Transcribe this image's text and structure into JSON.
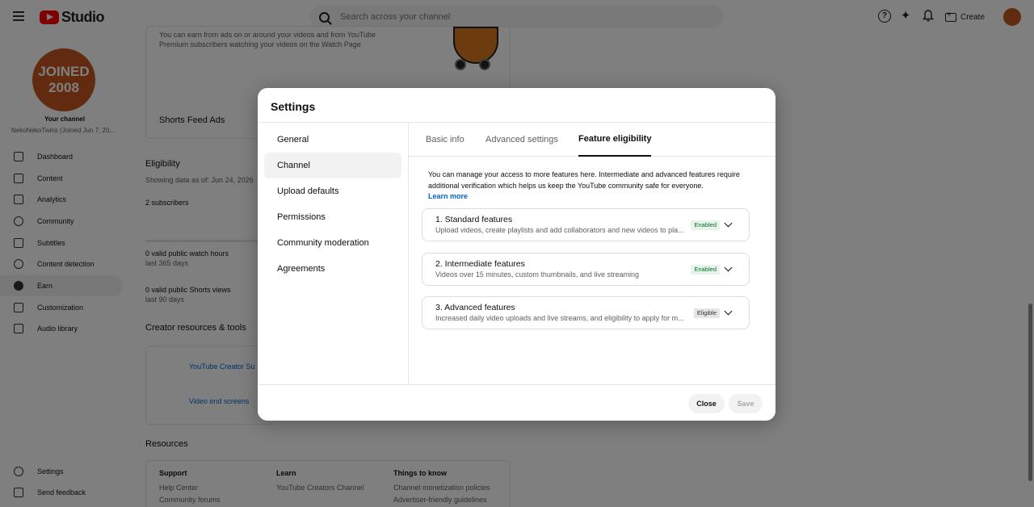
{
  "topbar": {
    "logo_text": "Studio",
    "search_placeholder": "Search across your channel",
    "create_label": "Create"
  },
  "sidebar": {
    "avatar_text_line1": "JOINED",
    "avatar_text_line2": "2008",
    "your_channel": "Your channel",
    "channel_name": "NekoNekoTwins (Joined Jun 7, 20...",
    "items": [
      {
        "label": "Dashboard",
        "icon": "dashboard-icon"
      },
      {
        "label": "Content",
        "icon": "content-icon"
      },
      {
        "label": "Analytics",
        "icon": "analytics-icon"
      },
      {
        "label": "Community",
        "icon": "community-icon"
      },
      {
        "label": "Subtitles",
        "icon": "subtitles-icon"
      },
      {
        "label": "Content detection",
        "icon": "copyright-icon"
      },
      {
        "label": "Earn",
        "icon": "dollar-icon"
      },
      {
        "label": "Customization",
        "icon": "wand-icon"
      },
      {
        "label": "Audio library",
        "icon": "audio-library-icon"
      }
    ],
    "settings": "Settings",
    "send_feedback": "Send feedback"
  },
  "background": {
    "earn_line1": "You can earn from ads on or around your videos and from YouTube",
    "earn_line2": "Premium subscribers watching your videos on the Watch Page",
    "shorts_feed_ads": "Shorts Feed Ads",
    "eligibility_title": "Eligibility",
    "showing_data": "Showing data as of: Jun 24, 2026",
    "subscribers": "2 subscribers",
    "watch_hours": "0 valid public watch hours",
    "last_365": "last 365 days",
    "shorts_views": "0 valid public Shorts views",
    "last_90": "last 90 days",
    "creator_resources": "Creator resources & tools",
    "creator_support": "YouTube Creator Su",
    "end_screens": "Video end screens",
    "resources_title": "Resources",
    "col_support": "Support",
    "help_center": "Help Center",
    "community_forums": "Community forums",
    "col_learn": "Learn",
    "creators_channel": "YouTube Creators Channel",
    "col_things": "Things to know",
    "monetization_policies": "Channel monetization policies",
    "advertiser_guidelines": "Advertiser-friendly guidelines"
  },
  "modal": {
    "title": "Settings",
    "left_items": [
      "General",
      "Channel",
      "Upload defaults",
      "Permissions",
      "Community moderation",
      "Agreements"
    ],
    "tabs": [
      "Basic info",
      "Advanced settings",
      "Feature eligibility"
    ],
    "intro": "You can manage your access to more features here. Intermediate and advanced features require additional verification which helps us keep the YouTube community safe for everyone.",
    "learn_more": "Learn more",
    "features": [
      {
        "title": "1. Standard features",
        "desc": "Upload videos, create playlists and add collaborators and new videos to pla...",
        "status": "Enabled"
      },
      {
        "title": "2. Intermediate features",
        "desc": "Videos over 15 minutes, custom thumbnails, and live streaming",
        "status": "Enabled"
      },
      {
        "title": "3. Advanced features",
        "desc": "Increased daily video uploads and live streams, and eligibility to apply for m...",
        "status": "Eligible"
      }
    ],
    "close_label": "Close",
    "save_label": "Save"
  }
}
